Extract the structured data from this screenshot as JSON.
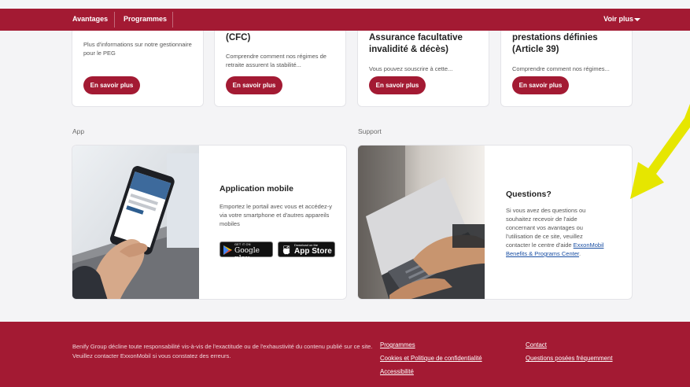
{
  "topbar": {
    "nav": [
      "Avantages",
      "Programmes"
    ],
    "more_label": "Voir plus"
  },
  "cards": [
    {
      "title": "",
      "desc": "Plus d'informations sur notre gestionnaire pour le PEG",
      "button": "En savoir plus"
    },
    {
      "title": "(CFC)",
      "desc": "Comprendre comment nos régimes de retraite assurent la stabilité...",
      "button": "En savoir plus"
    },
    {
      "title": "Assurance facultative invalidité & décès)",
      "desc": "Vous pouvez souscrire à cette...",
      "button": "En savoir plus"
    },
    {
      "title": "prestations définies (Article 39)",
      "desc": "Comprendre comment nos régimes...",
      "button": "En savoir plus"
    }
  ],
  "sections": {
    "app_label": "App",
    "support_label": "Support"
  },
  "app_card": {
    "title": "Application mobile",
    "desc": "Emportez le portail avec vous et accédez-y via votre smartphone et d'autres appareils mobiles",
    "google_play": {
      "small": "GET IT ON",
      "big": "Google play"
    },
    "app_store": {
      "small": "Download on the",
      "big": "App Store"
    }
  },
  "support_card": {
    "title": "Questions?",
    "desc": "Si vous avez des questions ou souhaitez recevoir de l'aide concernant vos avantages ou l'utilisation de ce site, veuillez contacter le centre d'aide",
    "link": "ExxonMobil Benefits & Programs Center",
    "link_suffix": "."
  },
  "footer": {
    "disclaimer_1": "Benify Group décline toute responsabilité vis-à-vis de l'exactitude ou de l'exhaustivité du contenu publié sur ce site.",
    "disclaimer_2": "Veuillez contacter ExxonMobil si vous constatez des erreurs.",
    "links_col1": [
      "Programmes",
      "Cookies et Politique de confidentialité",
      "Accessibilité"
    ],
    "links_col2": [
      "Contact",
      "Questions posées fréquemment"
    ]
  },
  "colors": {
    "brand": "#a31a33",
    "arrow": "#e6e600"
  }
}
